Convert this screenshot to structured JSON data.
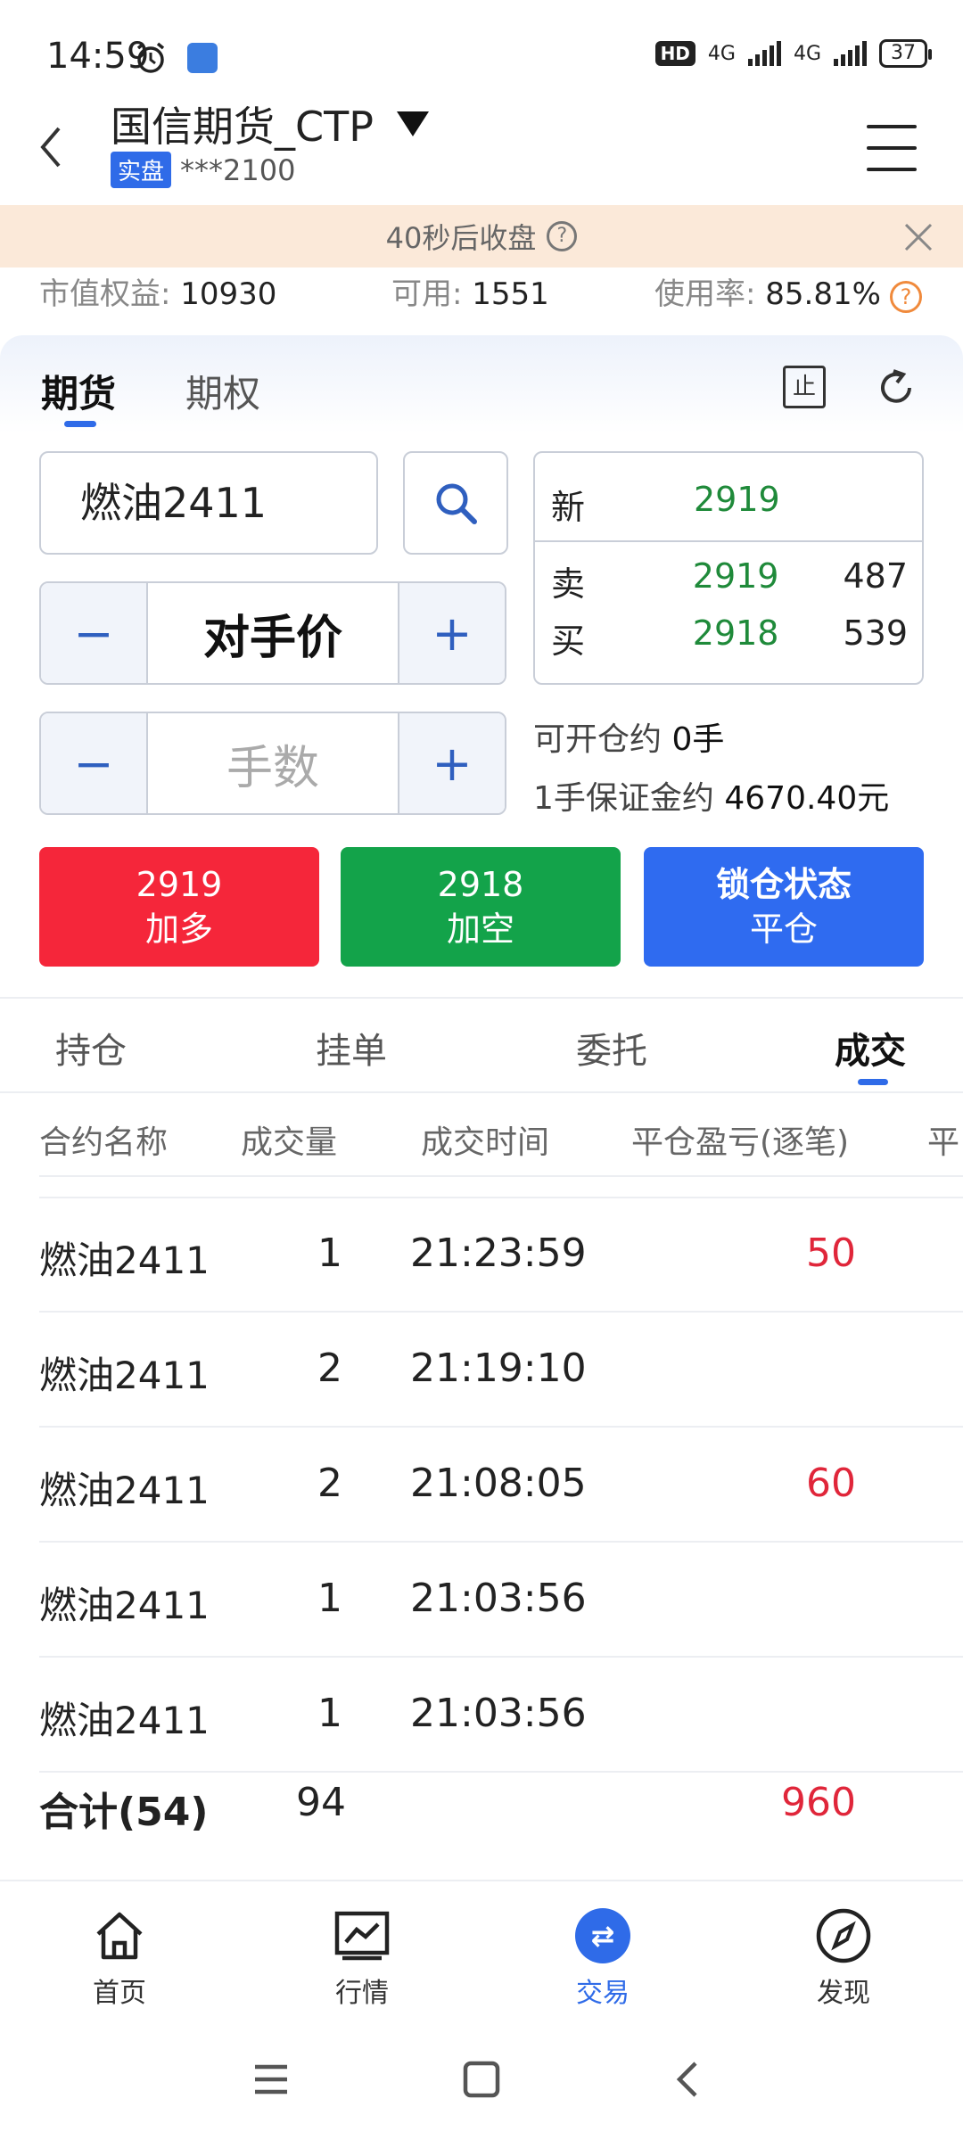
{
  "status_bar": {
    "time": "14:59",
    "hd": "HD",
    "net1": "4G",
    "net2": "4G",
    "battery": "37"
  },
  "header": {
    "title": "国信期货_CTP",
    "account_badge": "实盘",
    "account_no": "***2100"
  },
  "notice": {
    "text": "40秒后收盘"
  },
  "summary": {
    "equity_label": "市值权益:",
    "equity_value": "10930",
    "available_label": "可用:",
    "available_value": "1551",
    "usage_label": "使用率:",
    "usage_value": "85.81%"
  },
  "tabs": {
    "futures": "期货",
    "options": "期权"
  },
  "icons": {
    "stop_glyph": "止"
  },
  "order": {
    "contract": "燃油2411",
    "price_type": "对手价",
    "qty_placeholder": "手数",
    "minus": "−",
    "plus": "+"
  },
  "quote": {
    "last_label": "新",
    "last_price": "2919",
    "ask_label": "卖",
    "ask_price": "2919",
    "ask_vol": "487",
    "bid_label": "买",
    "bid_price": "2918",
    "bid_vol": "539"
  },
  "info": {
    "openable_label": "可开仓约",
    "openable_value": "0手",
    "margin_label": "1手保证金约",
    "margin_value": "4670.40元"
  },
  "actions": {
    "long_price": "2919",
    "long_label": "加多",
    "short_price": "2918",
    "short_label": "加空",
    "lock_label": "锁仓状态",
    "close_label": "平仓"
  },
  "bottom_tabs": [
    "持仓",
    "挂单",
    "委托",
    "成交"
  ],
  "table": {
    "headers": [
      "合约名称",
      "成交量",
      "成交时间",
      "平仓盈亏(逐笔)",
      "平"
    ],
    "rows": [
      {
        "name": "燃油2411",
        "vol": "1",
        "time": "21:23:59",
        "pnl": "50"
      },
      {
        "name": "燃油2411",
        "vol": "2",
        "time": "21:19:10",
        "pnl": ""
      },
      {
        "name": "燃油2411",
        "vol": "2",
        "time": "21:08:05",
        "pnl": "60"
      },
      {
        "name": "燃油2411",
        "vol": "1",
        "time": "21:03:56",
        "pnl": ""
      },
      {
        "name": "燃油2411",
        "vol": "1",
        "time": "21:03:56",
        "pnl": ""
      }
    ],
    "total": {
      "label": "合计(54)",
      "vol": "94",
      "pnl": "960"
    }
  },
  "nav": {
    "home": "首页",
    "market": "行情",
    "trade": "交易",
    "discover": "发现"
  }
}
